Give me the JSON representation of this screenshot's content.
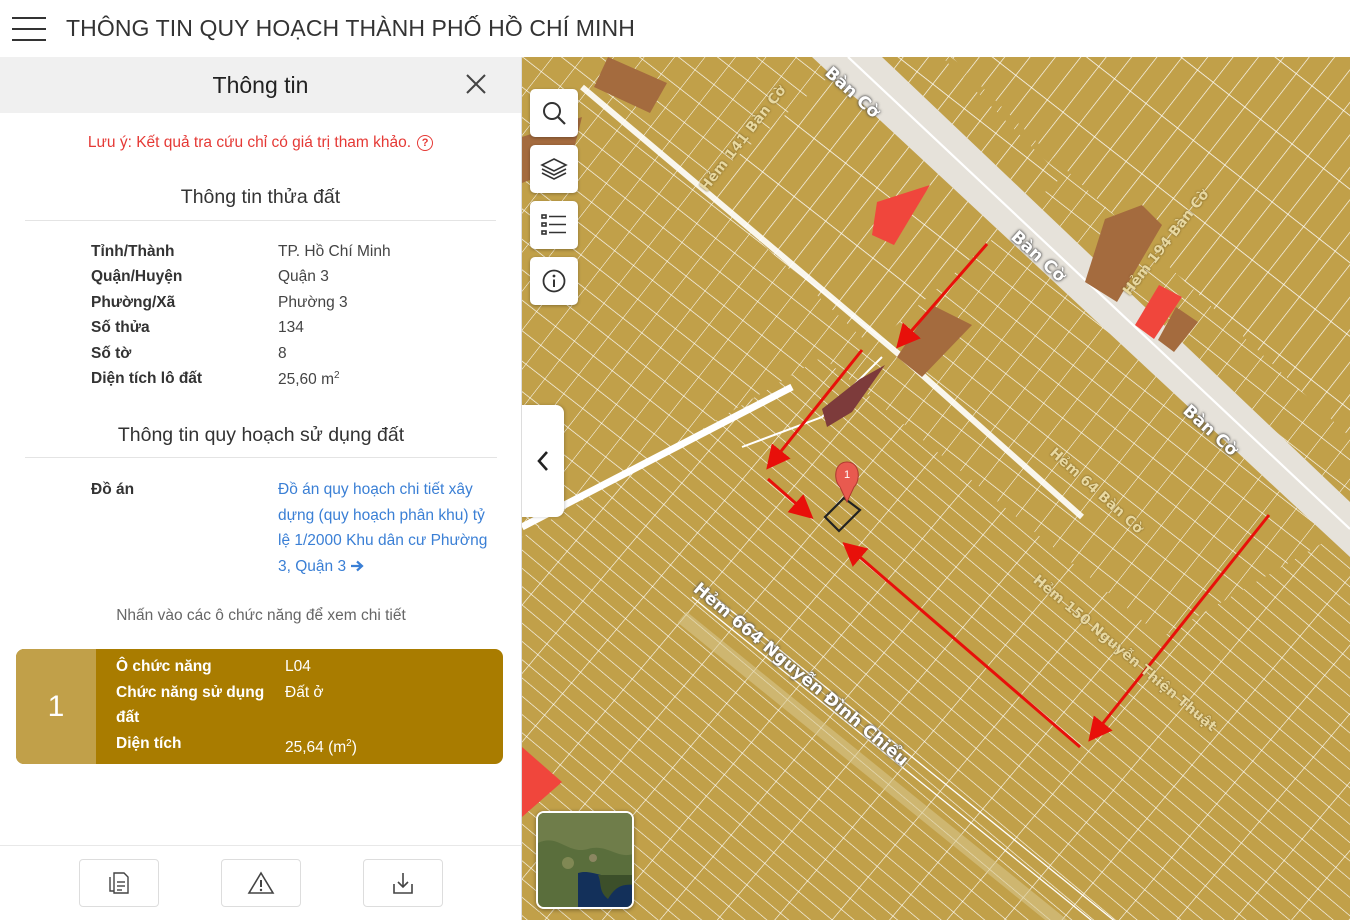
{
  "header": {
    "title": "THÔNG TIN QUY HOẠCH THÀNH PHỐ HỒ CHÍ MINH"
  },
  "panel": {
    "title": "Thông tin",
    "note": "Lưu ý: Kết quả tra cứu chỉ có giá trị tham khảo.",
    "parcel_section_title": "Thông tin thửa đất",
    "parcel": [
      {
        "label": "Tỉnh/Thành",
        "value": "TP. Hồ Chí Minh"
      },
      {
        "label": "Quận/Huyện",
        "value": "Quận 3"
      },
      {
        "label": "Phường/Xã",
        "value": "Phường 3"
      },
      {
        "label": "Số thửa",
        "value": "134"
      },
      {
        "label": "Số tờ",
        "value": "8"
      },
      {
        "label": "Diện tích lô đất",
        "value": "25,60 m",
        "unit_sup": "2"
      }
    ],
    "plan_section_title": "Thông tin quy hoạch sử dụng đất",
    "plan_label": "Đồ án",
    "plan_link": "Đồ án quy hoạch chi tiết xây dựng (quy hoạch phân khu) tỷ lệ 1/2000 Khu dân cư Phường 3, Quận 3",
    "hint": "Nhấn vào các ô chức năng để xem chi tiết",
    "zone": {
      "number": "1",
      "rows": [
        {
          "label": "Ô chức năng",
          "value": "L04"
        },
        {
          "label": "Chức năng sử dụng đất",
          "value": "Đất ở"
        },
        {
          "label": "Diện tích",
          "value": "25,64 (m",
          "sup": "2",
          "tail": ")"
        }
      ]
    }
  },
  "map": {
    "roads": [
      "Bàn Cờ",
      "Bàn Cờ",
      "Bàn Cờ",
      "Hẻm 141 Bàn Cờ",
      "Hẻm 664 Nguyễn Đình Chiểu",
      "Hẻm 194 Bàn Cờ",
      "Hẻm 64 Bàn Cờ",
      "Hẻm 150 Nguyễn Thiện Thuật"
    ],
    "marker_label": "1",
    "land_color": "#c1a049",
    "accent_red": "#f0463c"
  },
  "icons": [
    "menu-icon",
    "close-icon",
    "question-icon",
    "search-icon",
    "layers-icon",
    "list-icon",
    "info-icon",
    "chevron-left-icon",
    "document-icon",
    "warning-icon",
    "download-icon"
  ]
}
